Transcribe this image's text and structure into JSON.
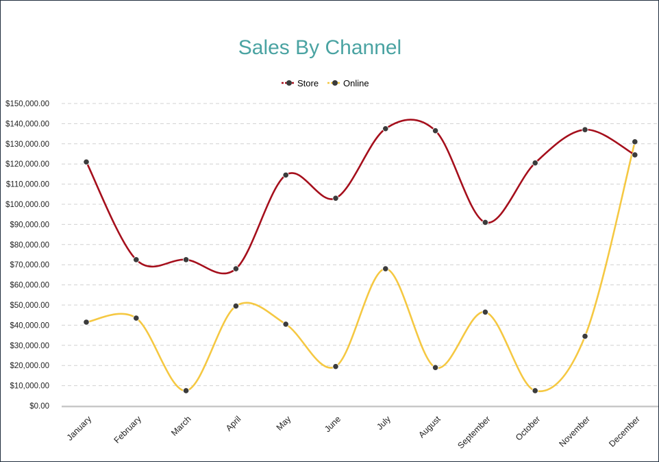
{
  "chart_data": {
    "type": "line",
    "title": "Sales By Channel",
    "categories": [
      "January",
      "February",
      "March",
      "April",
      "May",
      "June",
      "July",
      "August",
      "September",
      "October",
      "November",
      "December"
    ],
    "series": [
      {
        "name": "Store",
        "color": "#a50f1c",
        "values": [
          121000,
          72500,
          72500,
          68000,
          114500,
          103000,
          137500,
          136500,
          91000,
          120500,
          137000,
          124500
        ]
      },
      {
        "name": "Online",
        "color": "#f5c842",
        "values": [
          41500,
          43500,
          7500,
          49500,
          40500,
          19500,
          68000,
          19000,
          46500,
          7500,
          34500,
          131000
        ]
      }
    ],
    "yticks": [
      "$0.00",
      "$10,000.00",
      "$20,000.00",
      "$30,000.00",
      "$40,000.00",
      "$50,000.00",
      "$60,000.00",
      "$70,000.00",
      "$80,000.00",
      "$90,000.00",
      "$100,000.00",
      "$110,000.00",
      "$120,000.00",
      "$130,000.00",
      "$140,000.00",
      "$150,000.00"
    ],
    "ylim": [
      0,
      150000
    ],
    "grid": true,
    "legend": "top-center",
    "marker_color": "#3b3b3b",
    "xlabel": "",
    "ylabel": ""
  }
}
